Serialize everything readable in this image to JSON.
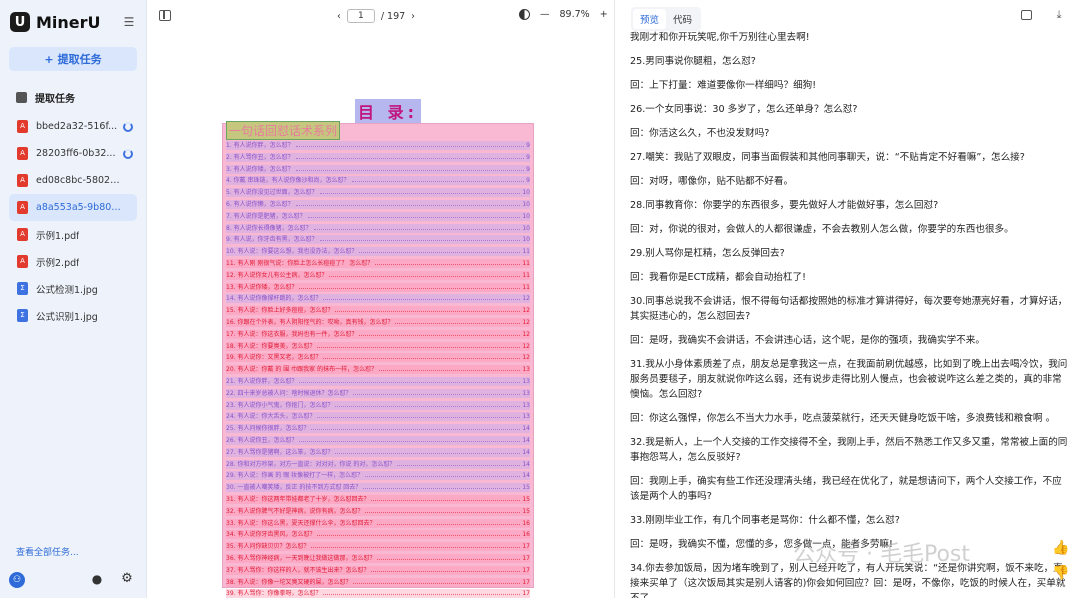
{
  "app": {
    "name": "MinerU",
    "logo_letter": "U",
    "extract_button": "提取任务",
    "section_title": "提取任务",
    "view_all": "查看全部任务...",
    "avatar_glyph": "⚇"
  },
  "tasks": [
    {
      "name": "bbed2a32-516f...",
      "type": "pdf",
      "status": "processing",
      "active": false
    },
    {
      "name": "28203ff6-0b32...",
      "type": "pdf",
      "status": "processing",
      "active": false
    },
    {
      "name": "ed08c8bc-5802-...",
      "type": "pdf",
      "status": "done",
      "active": false
    },
    {
      "name": "a8a553a5-9b80-...",
      "type": "pdf",
      "status": "done",
      "active": true
    },
    {
      "name": "示例1.pdf",
      "type": "pdf",
      "status": "done",
      "active": false
    },
    {
      "name": "示例2.pdf",
      "type": "pdf",
      "status": "done",
      "active": false
    },
    {
      "name": "公式检测1.jpg",
      "type": "img",
      "status": "done",
      "active": false
    },
    {
      "name": "公式识别1.jpg",
      "type": "img",
      "status": "done",
      "active": false
    }
  ],
  "viewer": {
    "current_page": "1",
    "total_pages": "/ 197",
    "zoom": "89.7%",
    "zoom_minus": "—",
    "zoom_plus": "+",
    "prev": "‹",
    "next": "›",
    "toc_title": "目 录:",
    "toc_subtitle": "一句话回怼话术系列",
    "toc_lines": [
      {
        "t": "1. 有人说你胖，怎么怼？",
        "p": "9",
        "c": "purple"
      },
      {
        "t": "2. 有人骂你丑，怎么怼？",
        "p": "9",
        "c": "purple"
      },
      {
        "t": "3. 有人说你矮，怎么怼？",
        "p": "9",
        "c": "purple"
      },
      {
        "t": "4. 你戴 串珠链，有人说你像沙和尚，怎么怼？",
        "p": "9",
        "c": "purple"
      },
      {
        "t": "5. 有人说你没见过世面，怎么怼？",
        "p": "10",
        "c": "purple"
      },
      {
        "t": "6. 有人说你懒，怎么怼？",
        "p": "10",
        "c": "purple"
      },
      {
        "t": "7. 有人说你是肥猪，怎么怼？",
        "p": "10",
        "c": "purple"
      },
      {
        "t": "8. 有人说你长得像猪，怎么怼？",
        "p": "10",
        "c": "purple"
      },
      {
        "t": "9. 有人说，你牙齿有黑，怎么怼？",
        "p": "10",
        "c": "purple"
      },
      {
        "t": "10. 有人说：你要这么想，我也没办法，怎么怼？",
        "p": "11",
        "c": "purple"
      },
      {
        "t": "11. 有人刚 刚很气说：你脸上怎么长痘痘了？ 怎么怼？",
        "p": "11",
        "c": "red"
      },
      {
        "t": "12. 有人说你女儿有公主病，怎么怼？",
        "p": "11",
        "c": "red"
      },
      {
        "t": "13. 有人说你矮，怎么怼？",
        "p": "11",
        "c": "red"
      },
      {
        "t": "14. 有人说你像撑杆跳的，怎么怼？",
        "p": "12",
        "c": "purple"
      },
      {
        "t": "15. 有人说：你脸上好多痘痘，怎么怼？",
        "p": "12",
        "c": "red"
      },
      {
        "t": "16. 你跟在个外表，有人阴阳怪气的：哎呦，真有钱，怎么怼？",
        "p": "12",
        "c": "red"
      },
      {
        "t": "17. 有人说：你这衣服，我妈也有一件，怎么怼？",
        "p": "12",
        "c": "red"
      },
      {
        "t": "18. 有人说：你要臭美，怎么怼？",
        "p": "12",
        "c": "red"
      },
      {
        "t": "19. 有人说你：又黑又老，怎么怼？",
        "p": "12",
        "c": "red"
      },
      {
        "t": "20. 有人说：你戴 的 围 巾跟我家 的抹布一样，怎么怼？",
        "p": "13",
        "c": "red"
      },
      {
        "t": "21. 有人说你胖，怎么怼？",
        "p": "13",
        "c": "purple"
      },
      {
        "t": "22. 四十来岁总被人问：啥时候退休？怎么怼？",
        "p": "13",
        "c": "purple"
      },
      {
        "t": "23. 有人说你小气鬼，你抠门，怎么怼？",
        "p": "13",
        "c": "purple"
      },
      {
        "t": "24. 有人说：你大舌头，怎么怼？",
        "p": "13",
        "c": "purple"
      },
      {
        "t": "25. 有人问候你很胖，怎么怼？",
        "p": "14",
        "c": "purple"
      },
      {
        "t": "26. 有人说你丑，怎么怼？",
        "p": "14",
        "c": "purple"
      },
      {
        "t": "27. 有人骂你是猪啊，这么笨，怎么怼？",
        "p": "14",
        "c": "purple"
      },
      {
        "t": "28. 你和对方吵架，对方一直说：对对对，你说 的对，怎么怼？",
        "p": "14",
        "c": "purple"
      },
      {
        "t": "29. 有人说：你画 的 眼 妆像被打了一样，怎么怼？",
        "p": "14",
        "c": "purple"
      },
      {
        "t": "30. 一直被人嘲笑矮，反正 的技不到方式怼 回去？",
        "p": "15",
        "c": "purple"
      },
      {
        "t": "31. 有人说：你这两年带娃都老了十岁，怎么怼回去？",
        "p": "15",
        "c": "red"
      },
      {
        "t": "32. 有人说你脾气不好是神病，说你有病，怎么怼？",
        "p": "15",
        "c": "red"
      },
      {
        "t": "33. 有人说：你这么黑，夏天还撑什么伞，怎么怼回去？",
        "p": "16",
        "c": "red"
      },
      {
        "t": "34. 有人说你牙齿黑风，怎么怼？",
        "p": "16",
        "c": "red"
      },
      {
        "t": "35. 有人问你缺贝贝？怎么怼？",
        "p": "17",
        "c": "red"
      },
      {
        "t": "36. 有人骂你神经病，一天到晚让我做这做那，怎么怼？",
        "p": "17",
        "c": "red"
      },
      {
        "t": "37. 有人骂你：你这样的人，就不该生出来？怎么怼？",
        "p": "17",
        "c": "red"
      },
      {
        "t": "38. 有人说：你像一坨又臭又硬的屎，怎么怼？",
        "p": "17",
        "c": "red"
      },
      {
        "t": "39. 有人骂你：你像拳呀，怎么怼？",
        "p": "17",
        "c": "red"
      }
    ]
  },
  "result": {
    "tab_preview": "预览",
    "tab_code": "代码",
    "paragraphs": [
      "我刚才和你开玩笑呢,你千万别往心里去啊!",
      "25.男同事说你腿粗，怎么怼?",
      "回：上下打量：难道要像你一样细吗？细狗!",
      "26.一个女同事说：30 多岁了，怎么还单身？怎么怼?",
      "回：你活这么久，不也没发财吗?",
      "27.嘲笑：我贴了双眼皮，同事当面假装和其他同事聊天，说：“不贴肯定不好看嘛”，怎么接?",
      "回：对呀，哪像你，贴不贴都不好看。",
      "28.同事教育你：你要学的东西很多，要先做好人才能做好事，怎么回怼?",
      "回：对，你说的很对，会做人的人都很谦虚，不会去教别人怎么做，你要学的东西也很多。",
      "29.别人骂你是杠精，怎么反弹回去?",
      "回：我看你是ECT成精，都会自动抬杠了!",
      "30.同事总说我不会讲话，恨不得每句话都按照她的标准才算讲得好，每次要夸她漂亮好看，才算好话，其实挺违心的，怎么怼回去?",
      "回：是呀，我确实不会讲话，不会讲违心话，这个呢，是你的强项，我确实学不来。",
      "31.我从小身体素质差了点，朋友总是拿我这一点，在我面前刷优越感，比如到了晚上出去喝冷饮，我问服务员要毯子，朋友就说你咋这么弱，还有说步走得比别人慢点，也会被说咋这么差之类的，真的非常懊恼。怎么回怼?",
      "回：你这么强悍，你怎么不当大力水手，吃点菠菜就行，还天天健身吃饭干啥，多浪费钱和粮食啊 。",
      "32.我是新人，上一个人交接的工作交接得不全，我刚上手，然后不熟悉工作又多又重，常常被上面的同事抱怨骂人，怎么反驳好?",
      "回：我刚上手，确实有些工作还没理清头绪，我已经在优化了，就是想请问下，两个人交接工作，不应该是两个人的事吗?",
      "33.刚刚毕业工作，有几个同事老是骂你：什么都不懂，怎么怼?",
      "回：是呀，我确实不懂，您懂的多，您多做一点，能者多劳嘛!",
      "34.你去参加饭局，因为堵车晚到了，别人已经开吃了，有人开玩笑说：“还是你讲究啊，饭不来吃，直接来买单了（这次饭局其实是别人请客的)你会如何回应？回：是呀，不像你，吃饭的时候人在，买单就不了。"
    ],
    "watermark": "公众号 · 毛毛Post"
  }
}
